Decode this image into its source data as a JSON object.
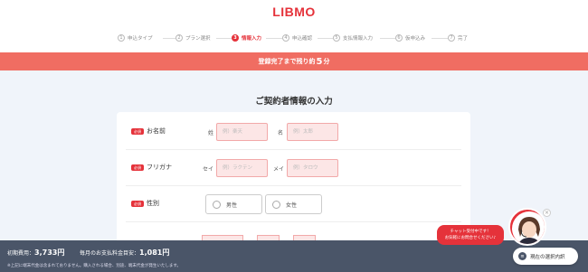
{
  "brand": {
    "logo": "LIBMO",
    "accent": "#e5323a",
    "banner_color": "#f06d62"
  },
  "steps": [
    {
      "num": "1",
      "label": "申込タイプ"
    },
    {
      "num": "2",
      "label": "プラン選択"
    },
    {
      "num": "3",
      "label": "情報入力"
    },
    {
      "num": "4",
      "label": "申込確認"
    },
    {
      "num": "5",
      "label": "支払情報入力"
    },
    {
      "num": "6",
      "label": "仮申込み"
    },
    {
      "num": "7",
      "label": "完了"
    }
  ],
  "banner": {
    "prefix": "登録完了まで残り約",
    "minutes": "5",
    "suffix": "分"
  },
  "title": "ご契約者情報の入力",
  "form": {
    "required_badge": "必須",
    "name": {
      "label": "お名前",
      "sei_label": "姓",
      "mei_label": "名",
      "sei_placeholder": "例）楽天",
      "mei_placeholder": "例）太郎"
    },
    "kana": {
      "label": "フリガナ",
      "sei_label": "セイ",
      "mei_label": "メイ",
      "sei_placeholder": "例）ラクテン",
      "mei_placeholder": "例）タロウ"
    },
    "gender": {
      "label": "性別",
      "options": [
        "男性",
        "女性"
      ]
    }
  },
  "footer": {
    "initial_label": "初期費用：",
    "initial_value": "3,733円",
    "monthly_label": "毎月のお支払料金目安：",
    "monthly_value": "1,081円",
    "note": "※上記に端末代金は含まれておりません。購入される場合、別途、端末代金が発生いたします。"
  },
  "chat": {
    "line1": "チャット受付中です！",
    "line2": "お気軽にお問合せください♪"
  },
  "selection_button": "現在の選択内訳"
}
